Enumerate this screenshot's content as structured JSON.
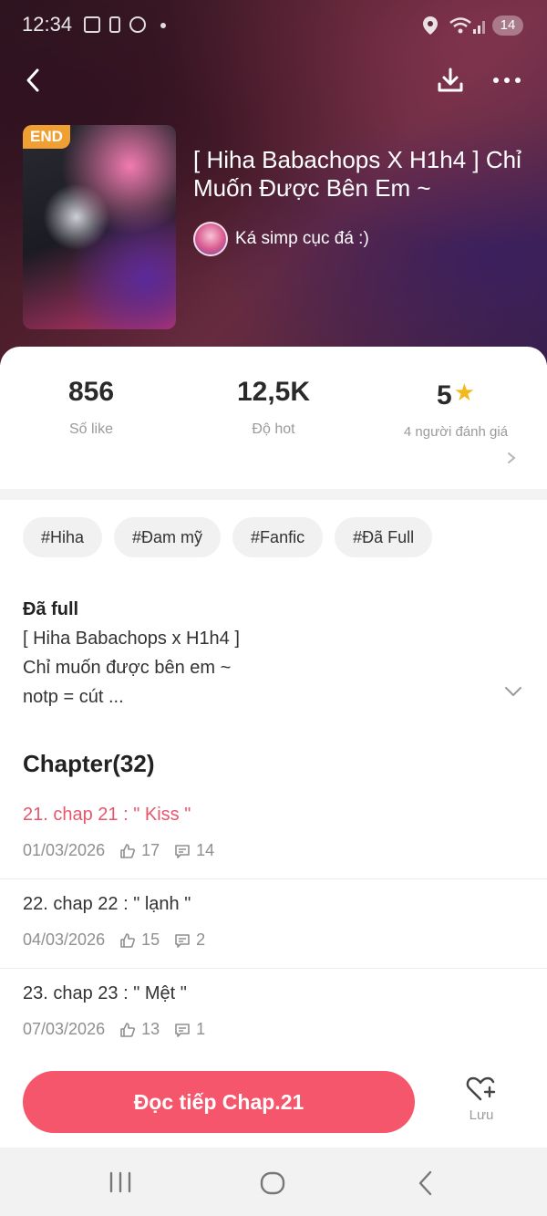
{
  "status_bar": {
    "time": "12:34",
    "battery": "14"
  },
  "header": {
    "end_badge": "END",
    "title": "[ Hiha Babachops X H1h4 ] Chỉ Muốn Được Bên Em ~",
    "author": "Ká simp cục đá :)"
  },
  "stats": [
    {
      "value": "856",
      "label": "Số like"
    },
    {
      "value": "12,5K",
      "label": "Độ hot"
    },
    {
      "value": "5",
      "label": "4 người đánh giá"
    }
  ],
  "tags": [
    "#Hiha",
    "#Đam mỹ",
    "#Fanfic",
    "#Đã Full"
  ],
  "description": {
    "heading": "Đã full",
    "line1": "[ Hiha Babachops x H1h4 ]",
    "line2": "Chỉ muốn được bên em ~",
    "line3": "notp = cút ..."
  },
  "chapters_heading": "Chapter(32)",
  "chapters": [
    {
      "title": "21. chap 21 : \" Kiss \"",
      "date": "01/03/2026",
      "likes": "17",
      "comments": "14"
    },
    {
      "title": "22. chap 22 : \" lạnh \"",
      "date": "04/03/2026",
      "likes": "15",
      "comments": "2"
    },
    {
      "title": "23. chap 23 : \" Mệt \"",
      "date": "07/03/2026",
      "likes": "13",
      "comments": "1"
    }
  ],
  "actions": {
    "read_button": "Đọc tiếp Chap.21",
    "save_label": "Lưu"
  },
  "colors": {
    "accent": "#f5566c",
    "active_chapter": "#e8566d",
    "star": "#f3b81b",
    "end_badge": "#f0a032"
  },
  "icons": [
    "back-icon",
    "download-icon",
    "more-icon",
    "star-icon",
    "chevron-right-icon",
    "chevron-down-icon",
    "thumbs-up-icon",
    "comment-icon",
    "heart-plus-icon",
    "recents-icon",
    "home-icon",
    "nav-back-icon"
  ]
}
